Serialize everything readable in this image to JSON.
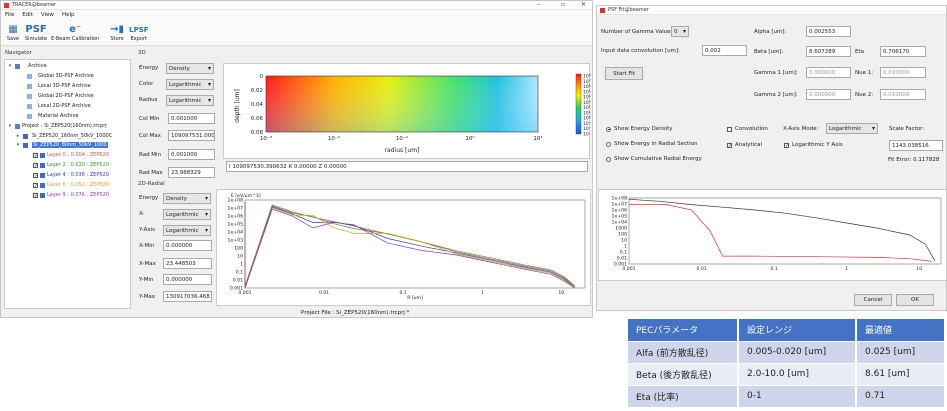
{
  "left_window": {
    "title": "TRACER@beamer",
    "menu": [
      "File",
      "Edit",
      "View",
      "Help"
    ],
    "toolbar": [
      {
        "label": "Save",
        "icon": "save-icon"
      },
      {
        "label": "Simulate",
        "icon": "psf-icon"
      },
      {
        "label": "E-Beam Calibration",
        "icon": "ebeam-icon"
      },
      {
        "label": "Store",
        "icon": "store-icon"
      },
      {
        "label": "Export",
        "icon": "export-icon"
      }
    ],
    "navigator_title": "Navigator",
    "tree": [
      {
        "label": "Archive"
      },
      {
        "label": "Global 3D-PSF Archive"
      },
      {
        "label": "Local 3D-PSF Archive"
      },
      {
        "label": "Global 2D-PSF Archive"
      },
      {
        "label": "Local 2D-PSF Archive"
      },
      {
        "label": "Material Archive"
      },
      {
        "label": "Project - Si_ZEP520(160nm).trcprj"
      },
      {
        "label": "Si_ZEP520_160nm_50kV_1000C"
      },
      {
        "label": "Si_ZEP520_80nm_50kV_1000"
      },
      {
        "label": "Layer 0 : 0.004 : ZEP520",
        "color": "#d9534f"
      },
      {
        "label": "Layer 2 : 0.020 : ZEP520",
        "color": "#2e9e2e"
      },
      {
        "label": "Layer 4 : 0.036 : ZEP520",
        "color": "#2b3fb5"
      },
      {
        "label": "Layer 6 : 0.052 : ZEP520",
        "color": "#e0a020"
      },
      {
        "label": "Layer 9 : 0.076 : ZEP520",
        "color": "#8c3fb0"
      }
    ],
    "panel3d": {
      "title": "3D",
      "energy_label": "Energy",
      "energy_value": "Density",
      "color_label": "Color",
      "color_value": "Logarithmic",
      "radius_label": "Radius",
      "radius_value": "Logarithmic",
      "col_min_label": "Col Min",
      "col_min_value": "0.001000",
      "col_max_label": "Col Max",
      "col_max_value": "109097531.000",
      "rad_min_label": "Rad Min",
      "rad_min_value": "0.001000",
      "rad_max_label": "Rad Max",
      "rad_max_value": "23.988329",
      "xlabel": "radius [um]",
      "ylabel": "depth [um]",
      "xticks": [
        "10⁻³",
        "10⁻²",
        "10⁻¹",
        "10⁰",
        "10¹"
      ],
      "yticks": [
        "0",
        "0.02",
        "0.04",
        "0.06",
        "0.08"
      ],
      "cbar_ticks": [
        "10⁸",
        "10⁷",
        "10⁶",
        "10⁵",
        "10⁴",
        "10³",
        "10²",
        "10¹",
        "10⁰",
        "10⁻¹",
        "10⁻²",
        "10⁻³"
      ],
      "status": "I 109097530.390632 R 0.00000 Z 0.00000"
    },
    "panel2d": {
      "title": "2D-Radial",
      "energy_label": "Energy",
      "energy_value": "Density",
      "x_label": "X-",
      "x_value": "Logarithmic",
      "yaxis_label": "Y-Axis",
      "yaxis_value": "Logarithmic",
      "xmin_label": "X-Min",
      "xmin_value": "0.000000",
      "xmax_label": "X-Max",
      "xmax_value": "23.448503",
      "ymin_label": "Y-Min",
      "ymin_value": "0.000000",
      "ymax_label": "Y-Max",
      "ymax_value": "130917036.468",
      "ylabel": "E [eV/um^3]",
      "xlabel": "R [um]",
      "yticks": [
        "1e+08",
        "1e+07",
        "1e+06",
        "1e+05",
        "1e+04",
        "1e+03",
        "100",
        "10",
        "1",
        "0.1",
        "0.01",
        "0.001"
      ],
      "xticks": [
        "0.001",
        "0.01",
        "0.1",
        "1",
        "10"
      ]
    },
    "statusbar": "Project File :  Si_ZEP520(160nm).trcprj *"
  },
  "right_window": {
    "title": "PSF Fit@beamer",
    "num_gamma_label": "Number of Gamma Values:",
    "num_gamma_value": "0",
    "input_conv_label": "Input data convolution [um]:",
    "input_conv_value": "0.002",
    "start_fit": "Start Fit",
    "alpha_label": "Alpha [um]:",
    "alpha_value": "0.002553",
    "beta_label": "Beta [um]:",
    "beta_value": "8.607289",
    "eta_label": "Eta",
    "eta_value": "0.706170",
    "gamma1_label": "Gamma 1 [um]:",
    "gamma1_value": "0.300000",
    "nue1_label": "Nue 1:",
    "nue1_value": "0.010000",
    "gamma2_label": "Gamma 2 [um]:",
    "gamma2_value": "2.000000",
    "nue2_label": "Nue 2:",
    "nue2_value": "0.010000",
    "show_energy_density": "Show Energy Density",
    "show_energy_radial": "Show Energy in Radial Section",
    "show_cumulative": "Show Cumulative Radial Energy",
    "convolution": "Convolution",
    "analytical": "Analytical",
    "xaxis_mode_label": "X-Axis Mode:",
    "xaxis_mode_value": "Logarithmic",
    "log_y": "Logarithmic Y Axis",
    "scale_factor_label": "Scale Factor:",
    "scale_factor_value": "1143.038516",
    "fit_error": "Fit Error: 0.117828",
    "plot_yticks": [
      "1e+08",
      "1e+07",
      "1e+06",
      "1e+05",
      "1e+04",
      "1000",
      "100",
      "10",
      "1",
      "0.1",
      "0.01",
      "0.001"
    ],
    "plot_xticks": [
      "0.001",
      "0.01",
      "0.1",
      "1",
      "10"
    ],
    "cancel": "Cancel",
    "ok": "OK"
  },
  "pec_table": {
    "headers": [
      "PECパラメータ",
      "設定レンジ",
      "最適値"
    ],
    "rows": [
      [
        "Alfa (前方散乱径)",
        "0.005-0.020 [um]",
        "0.025 [um]"
      ],
      [
        "Beta (後方散乱径)",
        "2.0-10.0 [um]",
        "8.61 [um]"
      ],
      [
        "Eta (比率)",
        "0-1",
        "0.71"
      ]
    ],
    "header_color": "#4472c4"
  }
}
